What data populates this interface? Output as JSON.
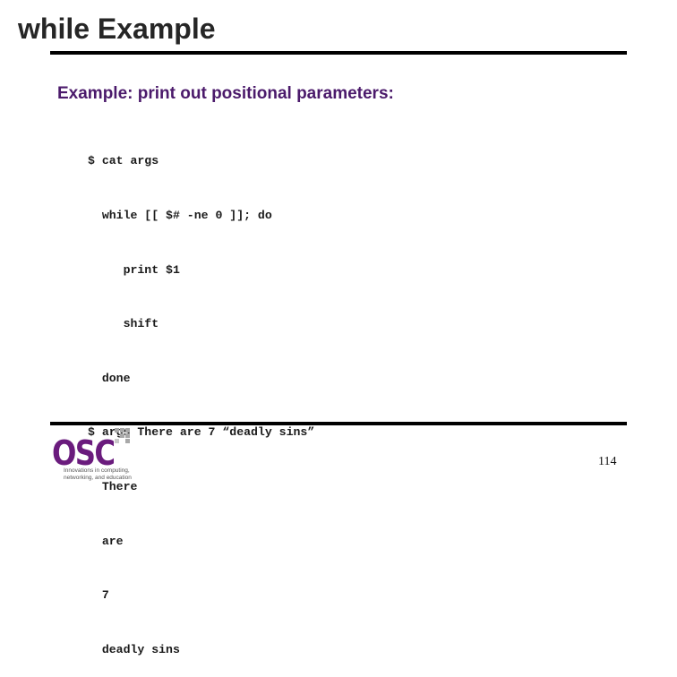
{
  "slide": {
    "title": "while Example",
    "subtitle": "Example: print out positional parameters:",
    "code_lines": [
      "$ cat args",
      "  while [[ $# -ne 0 ]]; do",
      "     print $1",
      "     shift",
      "  done",
      "$ args There are 7 “deadly sins”",
      "  There",
      "  are",
      "  7",
      "  deadly sins"
    ],
    "page_number": "114"
  },
  "logo": {
    "name": "OSC",
    "tagline_line1": "Innovations in computing,",
    "tagline_line2": "networking, and education",
    "color": "#6a1b7d"
  },
  "colors": {
    "title": "#262626",
    "subtitle": "#4b1a6b",
    "rule": "#000000"
  }
}
